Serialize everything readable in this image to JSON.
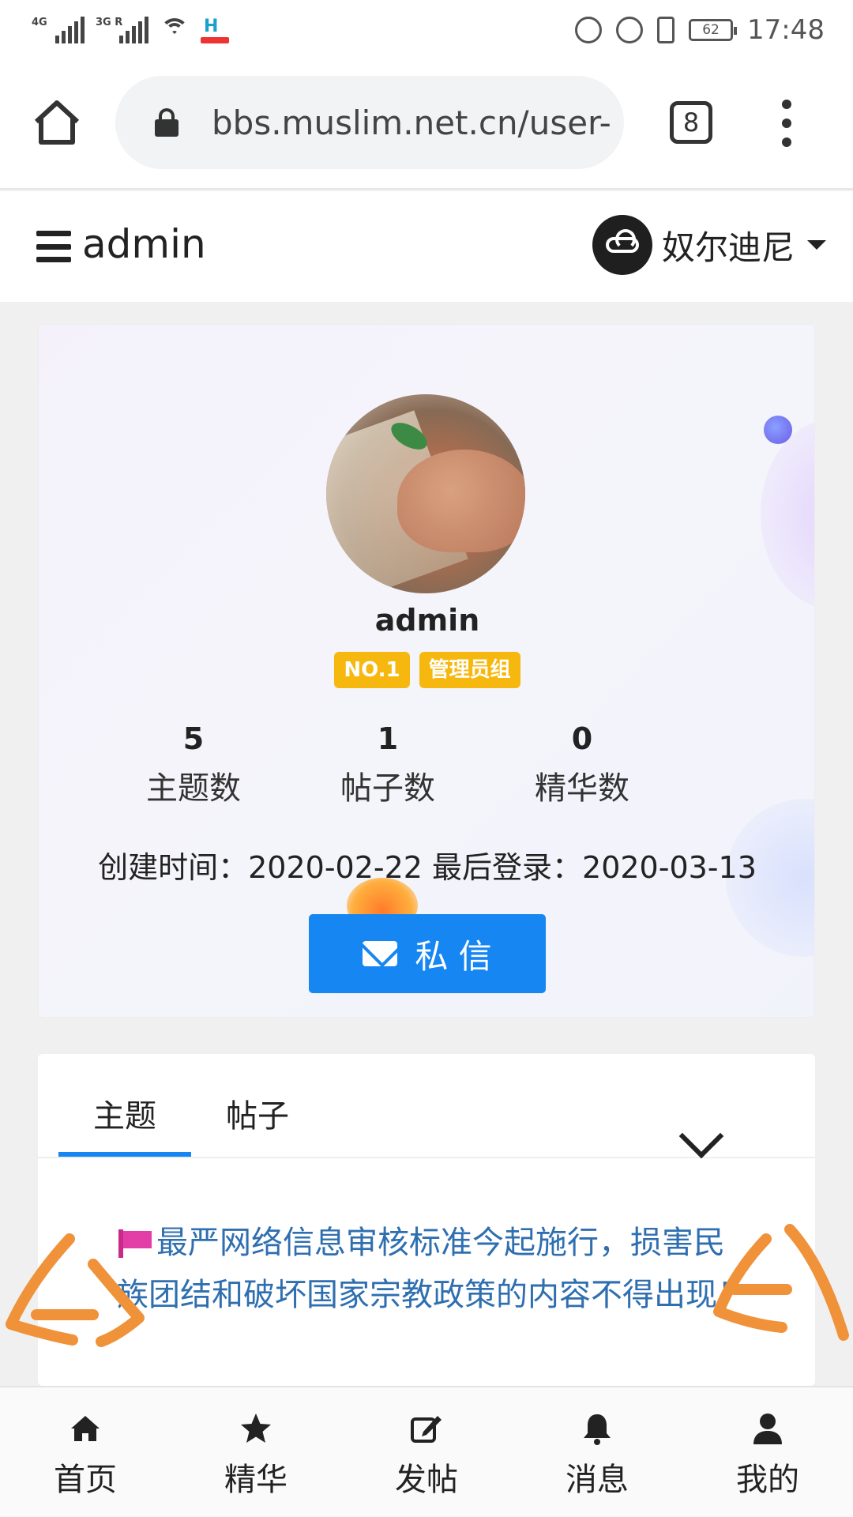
{
  "status_bar": {
    "signal1_tag": "4G",
    "signal2_tag": "3G R",
    "battery": "62",
    "time": "17:48"
  },
  "browser": {
    "url": "bbs.muslim.net.cn/user-",
    "tab_count": "8"
  },
  "site_header": {
    "title": "admin",
    "user_name": "奴尔迪尼"
  },
  "profile": {
    "name": "admin",
    "badges": [
      "NO.1",
      "管理员组"
    ],
    "stats": [
      {
        "value": "5",
        "label": "主题数"
      },
      {
        "value": "1",
        "label": "帖子数"
      },
      {
        "value": "0",
        "label": "精华数"
      }
    ],
    "dates_line": "创建时间：2020-02-22 最后登录：2020-03-13",
    "pm_button": "私 信"
  },
  "posts": {
    "tabs": [
      "主题",
      "帖子"
    ],
    "active_tab": "主题",
    "items": [
      {
        "title": "最严网络信息审核标准今起施行，损害民族团结和破坏国家宗教政策的内容不得出现！"
      }
    ]
  },
  "bottom_nav": [
    {
      "label": "首页",
      "icon": "home-icon"
    },
    {
      "label": "精华",
      "icon": "star-icon"
    },
    {
      "label": "发帖",
      "icon": "edit-icon"
    },
    {
      "label": "消息",
      "icon": "bell-icon"
    },
    {
      "label": "我的",
      "icon": "user-icon"
    }
  ],
  "colors": {
    "accent": "#1686f2",
    "badge": "#f6b80e",
    "link": "#2f6fb0",
    "annotation": "#f0923a"
  }
}
